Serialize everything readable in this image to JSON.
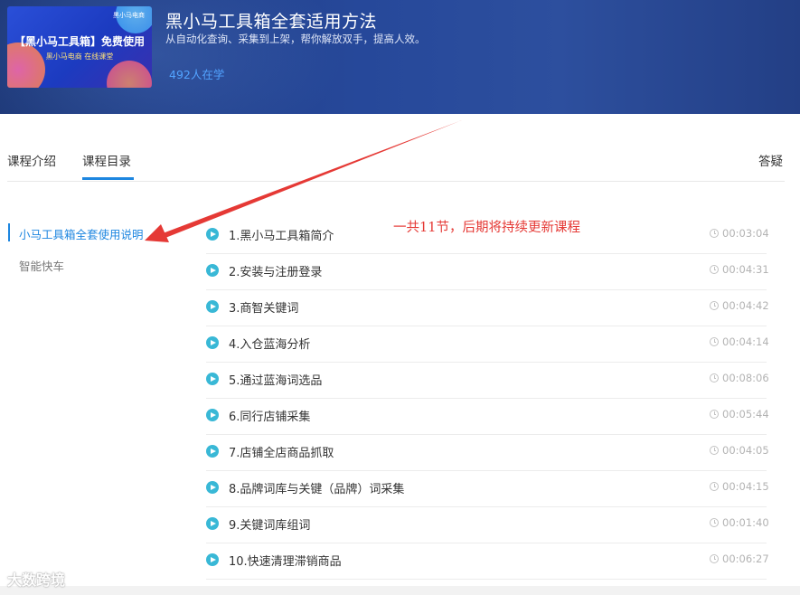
{
  "header": {
    "cover": {
      "brand": "黑小马电商",
      "title": "【黑小马工具箱】免费使用",
      "subtitle": "黑小马电商 在线课堂"
    },
    "title": "黑小马工具箱全套适用方法",
    "description": "从自动化查询、采集到上架，帮你解放双手，提高人效。",
    "learners": "492人在学"
  },
  "tabs": {
    "intro": "课程介绍",
    "catalog": "课程目录",
    "qa": "答疑"
  },
  "sidebar": {
    "items": [
      {
        "label": "小马工具箱全套使用说明",
        "active": true
      },
      {
        "label": "智能快车",
        "active": false
      }
    ]
  },
  "annotation": "一共11节，后期将持续更新课程",
  "lessons": [
    {
      "name": "1.黑小马工具箱简介",
      "duration": "00:03:04"
    },
    {
      "name": "2.安装与注册登录",
      "duration": "00:04:31"
    },
    {
      "name": "3.商智关键词",
      "duration": "00:04:42"
    },
    {
      "name": "4.入仓蓝海分析",
      "duration": "00:04:14"
    },
    {
      "name": "5.通过蓝海词选品",
      "duration": "00:08:06"
    },
    {
      "name": "6.同行店铺采集",
      "duration": "00:05:44"
    },
    {
      "name": "7.店铺全店商品抓取",
      "duration": "00:04:05"
    },
    {
      "name": "8.品牌词库与关键（品牌）词采集",
      "duration": "00:04:15"
    },
    {
      "name": "9.关键词库组词",
      "duration": "00:01:40"
    },
    {
      "name": "10.快速清理滞销商品",
      "duration": "00:06:27"
    }
  ],
  "watermark": "大数跨境",
  "colors": {
    "accent": "#1d86e0",
    "play_icon": "#39b8d6",
    "annotation": "#e53935",
    "learners": "#52a3ff"
  },
  "icons": {
    "lesson": "play-circle-icon",
    "duration": "clock-icon"
  }
}
